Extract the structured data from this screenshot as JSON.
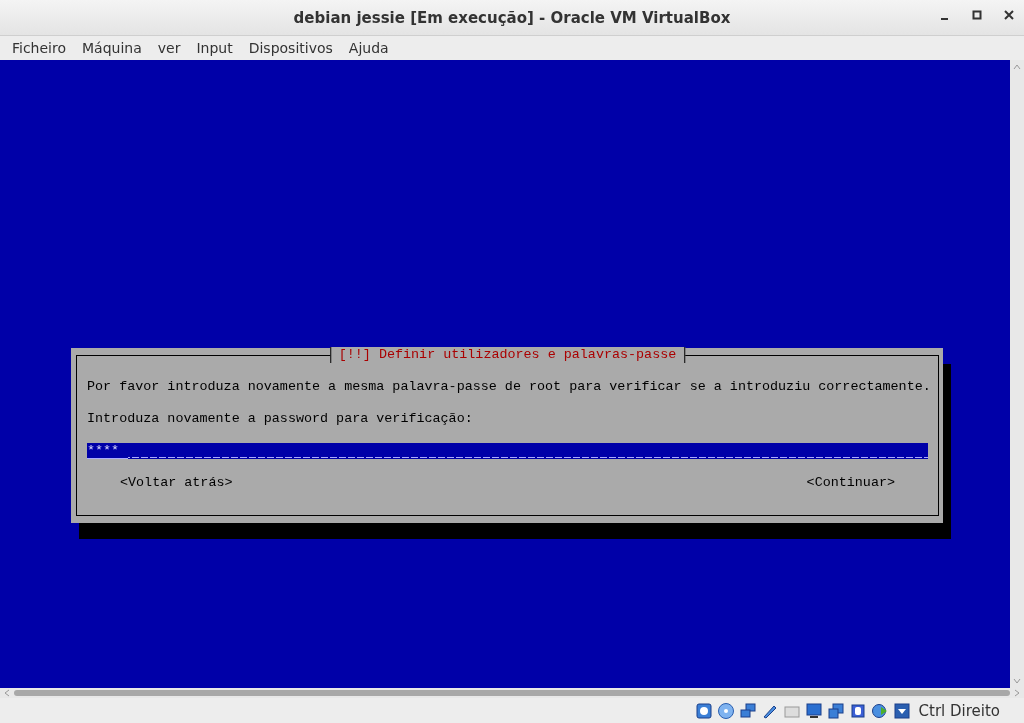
{
  "window": {
    "title": "debian jessie [Em execução] - Oracle VM VirtualBox"
  },
  "menu": [
    "Ficheiro",
    "Máquina",
    "ver",
    "Input",
    "Dispositivos",
    "Ajuda"
  ],
  "dialog": {
    "title": "[!!] Definir utilizadores e palavras-passe",
    "message": "Por favor introduza novamente a mesma palavra-passe de root para verificar se a introduziu correctamente.",
    "prompt": "Introduza novamente a password para verificação:",
    "password": {
      "value": "****"
    },
    "buttons": [
      "<Voltar atrás>",
      "<Continuar>"
    ]
  },
  "status_bar": {
    "host_key": "Ctrl Direito"
  }
}
